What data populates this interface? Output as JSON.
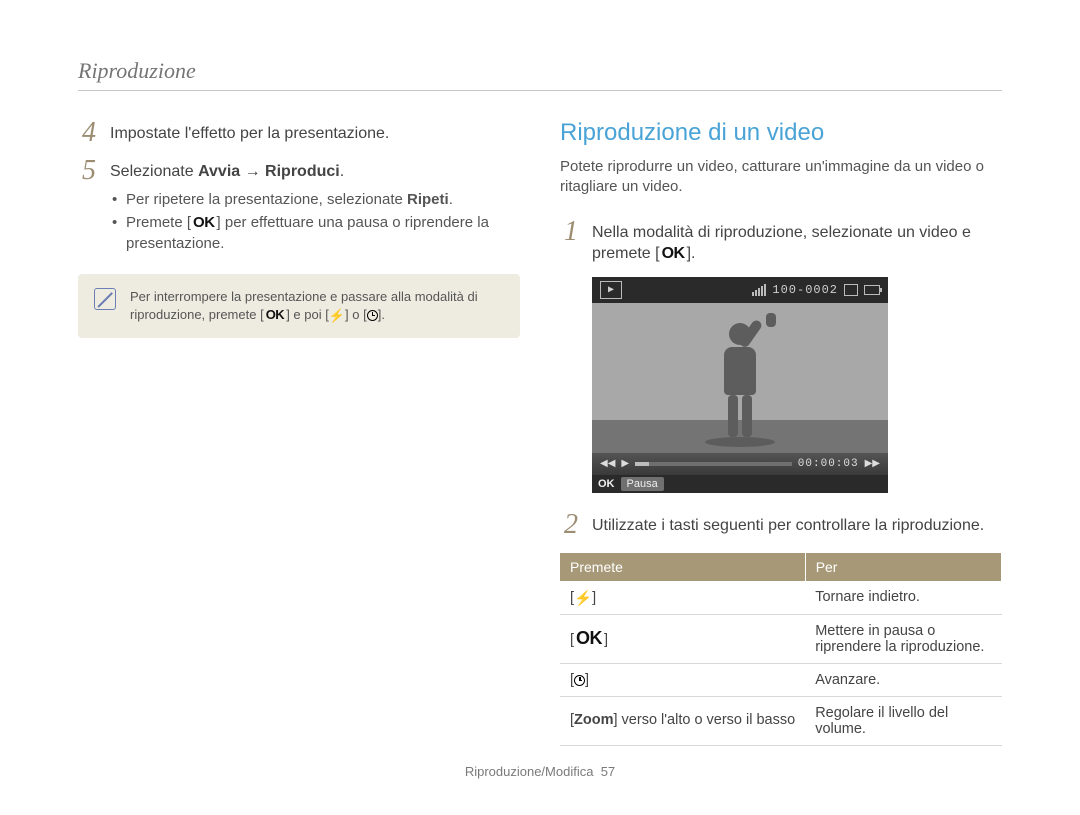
{
  "header": {
    "section_title": "Riproduzione"
  },
  "left": {
    "step4": {
      "num": "4",
      "text": "Impostate l'effetto per la presentazione."
    },
    "step5": {
      "num": "5",
      "prefix": "Selezionate ",
      "bold": "Avvia → Riproduci",
      "suffix": ".",
      "bullets": {
        "b1_pre": "Per ripetere la presentazione, selezionate ",
        "b1_bold": "Ripeti",
        "b1_post": ".",
        "b2_pre": "Premete [",
        "b2_ok": "OK",
        "b2_post": "] per effettuare una pausa o riprendere la presentazione."
      }
    },
    "note": {
      "line1_pre": "Per interrompere la presentazione e passare alla modalità di riproduzione, premete [",
      "ok": "OK",
      "mid": "] e poi [",
      "flash": "⚡",
      "or": "] o [",
      "timer": "⏱",
      "end": "]."
    }
  },
  "right": {
    "heading": "Riproduzione di un video",
    "intro": "Potete riprodurre un video, catturare un'immagine da un video o ritagliare un video.",
    "step1": {
      "num": "1",
      "text_pre": "Nella modalità di riproduzione, selezionate un video e premete [",
      "ok": "OK",
      "text_post": "]."
    },
    "camera": {
      "counter": "100-0002",
      "time": "00:00:03",
      "bottom_ok": "OK",
      "bottom_label": "Pausa"
    },
    "step2": {
      "num": "2",
      "text": "Utilizzate i tasti seguenti per controllare la riproduzione."
    },
    "table": {
      "head1": "Premete",
      "head2": "Per",
      "rows": {
        "r1_key_open": "[",
        "r1_key_icon": "⚡",
        "r1_key_close": "]",
        "r1_val": "Tornare indietro.",
        "r2_key_open": "[",
        "r2_key_ok": "OK",
        "r2_key_close": "]",
        "r2_val": "Mettere in pausa o riprendere la riproduzione.",
        "r3_key_open": "[",
        "r3_key_icon": "⏱",
        "r3_key_close": "]",
        "r3_val": "Avanzare.",
        "r4_key_open": "[",
        "r4_key_bold": "Zoom",
        "r4_key_rest": "] verso l'alto o verso il basso",
        "r4_val": "Regolare il livello del volume."
      }
    }
  },
  "footer": {
    "text": "Riproduzione/Modifica",
    "page": "57"
  }
}
